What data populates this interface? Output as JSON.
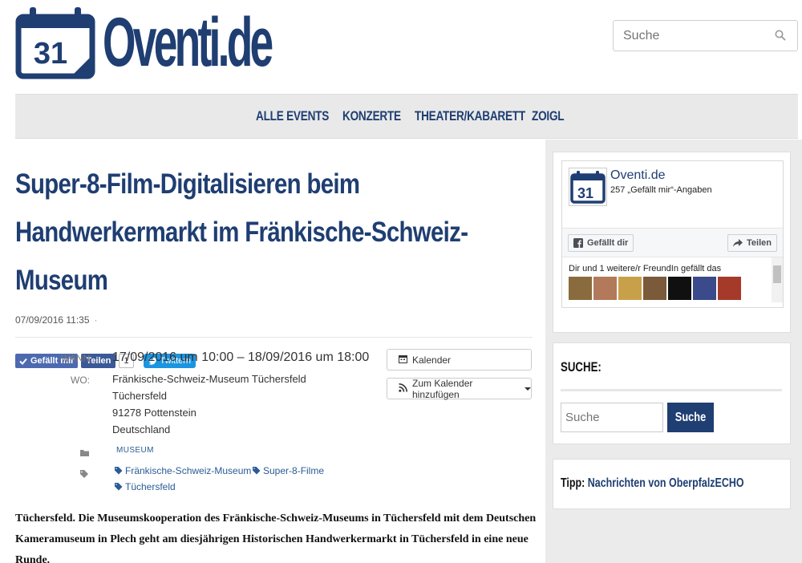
{
  "site": {
    "logo_number": "31",
    "logo_text": "Oventi.de"
  },
  "header_search": {
    "placeholder": "Suche"
  },
  "nav": {
    "items": [
      {
        "label": "ALLE EVENTS"
      },
      {
        "label": "KONZERTE"
      },
      {
        "label": "THEATER/KABARETT"
      },
      {
        "label": "ZOIGL"
      }
    ]
  },
  "post": {
    "title": "Super-8-Film-Digitalisieren beim Handwerkermarkt im Fränkische-Schweiz-Museum",
    "date": "07/09/2016 11:35",
    "meta_separator": "·",
    "share": {
      "like_label": "Gefällt mir",
      "share_label": "Teilen",
      "share_count": "1",
      "tweet_label": "Twittern"
    },
    "event": {
      "when_label": "WANN:",
      "when_value": "17/09/2016 um 10:00 – 18/09/2016 um 18:00",
      "where_label": "WO:",
      "where_lines": [
        "Fränkische-Schweiz-Museum Tüchersfeld",
        "Tüchersfeld",
        "91278 Pottenstein",
        "Deutschland"
      ],
      "calendar_button": "Kalender",
      "add_calendar_button": "Zum Kalender hinzufügen",
      "category": "MUSEUM",
      "tags": [
        "Fränkische-Schweiz-Museum",
        "Super-8-Filme",
        "Tüchersfeld"
      ]
    },
    "body": "Tüchersfeld. Die Museumskooperation des Fränkische-Schweiz-Museums in Tüchersfeld mit dem Deutschen Kameramuseum in Plech geht am diesjährigen Historischen Handwerkermarkt in Tüchersfeld in eine neue Runde."
  },
  "sidebar": {
    "fb_widget": {
      "page_name": "Oventi.de",
      "likes_text": "257 „Gefällt mir“-Angaben",
      "like_button": "Gefällt dir",
      "share_button": "Teilen",
      "friends_text": "Dir und 1 weitere/r FreundIn gefällt das",
      "avatar_colors": [
        "#8a6b3e",
        "#b27a5a",
        "#c9a04a",
        "#7a5a3a",
        "#101010",
        "#3a4a8a",
        "#a63a2a"
      ]
    },
    "search_widget": {
      "title": "SUCHE:",
      "placeholder": "Suche",
      "button": "Suche"
    },
    "tip_widget": {
      "prefix": "Tipp:",
      "link": "Nachrichten von OberpfalzECHO"
    }
  },
  "colors": {
    "brand": "#1f3e72",
    "facebook": "#3b5998",
    "twitter": "#1b95e0"
  }
}
